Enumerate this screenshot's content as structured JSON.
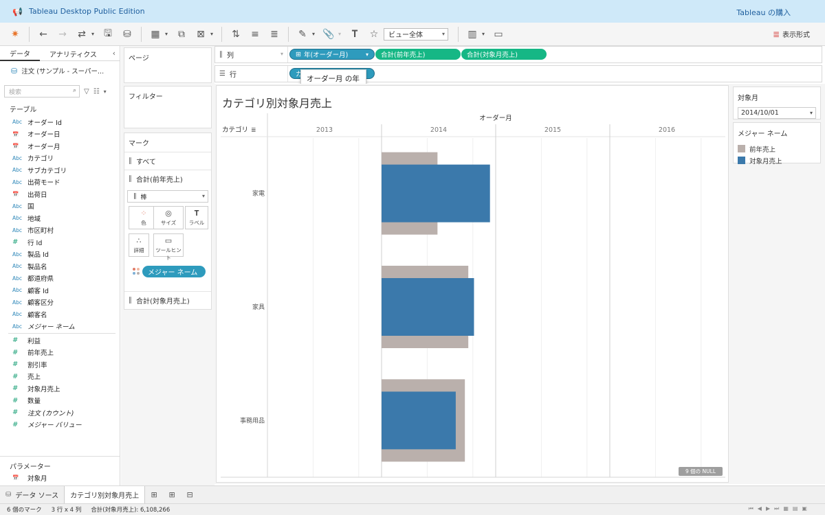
{
  "window": {
    "title": "Tableau Desktop Public Edition",
    "buy_link": "Tableau の購入"
  },
  "toolbar": {
    "view_size": "ビュー全体",
    "show_me": "表示形式",
    "icons": [
      "tableau-logo-icon",
      "undo-icon",
      "redo-icon",
      "replay-icon",
      "save-icon",
      "new-datasource-icon",
      "new-worksheet-icon",
      "duplicate-icon",
      "clear-icon",
      "swap-icon",
      "sort-asc-icon",
      "sort-desc-icon",
      "highlight-icon",
      "group-icon",
      "label-icon",
      "pin-icon",
      "show-cards-icon",
      "presentation-icon"
    ]
  },
  "data_pane": {
    "tabs": [
      "データ",
      "アナリティクス"
    ],
    "datasource": "注文 (サンプル - スーパー...",
    "search_placeholder": "検索",
    "tables_header": "テーブル",
    "dimensions": [
      {
        "type": "Abc",
        "name": "オーダー Id"
      },
      {
        "type": "date",
        "name": "オーダー日"
      },
      {
        "type": "date",
        "name": "オーダー月"
      },
      {
        "type": "Abc",
        "name": "カテゴリ"
      },
      {
        "type": "Abc",
        "name": "サブカテゴリ"
      },
      {
        "type": "Abc",
        "name": "出荷モード"
      },
      {
        "type": "date",
        "name": "出荷日"
      },
      {
        "type": "Abc",
        "name": "国"
      },
      {
        "type": "Abc",
        "name": "地域"
      },
      {
        "type": "Abc",
        "name": "市区町村"
      },
      {
        "type": "#",
        "name": "行 Id"
      },
      {
        "type": "Abc",
        "name": "製品 Id"
      },
      {
        "type": "Abc",
        "name": "製品名"
      },
      {
        "type": "Abc",
        "name": "都道府県"
      },
      {
        "type": "Abc",
        "name": "顧客 Id"
      },
      {
        "type": "Abc",
        "name": "顧客区分"
      },
      {
        "type": "Abc",
        "name": "顧客名"
      },
      {
        "type": "Abc",
        "name": "メジャー ネーム",
        "italic": true
      }
    ],
    "measures": [
      {
        "type": "#",
        "name": "利益"
      },
      {
        "type": "#",
        "name": "前年売上"
      },
      {
        "type": "#",
        "name": "割引率"
      },
      {
        "type": "#",
        "name": "売上"
      },
      {
        "type": "#",
        "name": "対象月売上"
      },
      {
        "type": "#",
        "name": "数量"
      },
      {
        "type": "#",
        "name": "注文 (カウント)",
        "italic": true
      },
      {
        "type": "#",
        "name": "メジャー バリュー",
        "italic": true
      }
    ],
    "parameters_header": "パラメーター",
    "parameters": [
      {
        "type": "date",
        "name": "対象月"
      }
    ]
  },
  "shelves": {
    "pages_label": "ページ",
    "filters_label": "フィルター",
    "marks_label": "マーク",
    "marks_all": "すべて",
    "marks_card1": "合計(前年売上)",
    "mark_type": "棒",
    "mark_buttons": [
      "色",
      "サイズ",
      "ラベル",
      "詳細",
      "ツールヒント"
    ],
    "color_pill": "メジャー ネーム",
    "marks_card2": "合計(対象月売上)",
    "columns_label": "列",
    "rows_label": "行",
    "columns_pills": [
      "年(オーダー月)",
      "合計(前年売上)",
      "合計(対象月売上)"
    ],
    "rows_pill_prefix": "カ",
    "tooltip": "オーダー月 の年"
  },
  "view": {
    "title": "カテゴリ別対象月売上",
    "null_badge": "9 個の NULL"
  },
  "chart_data": {
    "type": "bar",
    "column_header": "オーダー月",
    "row_header": "カテゴリ",
    "years": [
      "2013",
      "2014",
      "2015",
      "2016"
    ],
    "categories": [
      "家電",
      "家具",
      "事務用品"
    ],
    "series": [
      {
        "name": "前年売上",
        "color": "#bab0ac",
        "values": [
          0.49,
          0.76,
          0.73
        ]
      },
      {
        "name": "対象月売上",
        "color": "#3b79ab",
        "values": [
          0.95,
          0.81,
          0.65
        ]
      }
    ],
    "bar_year": "2014",
    "value_scale": "fraction of the 2014 column width"
  },
  "legends": {
    "param_title": "対象月",
    "param_value": "2014/10/01",
    "color_title": "メジャー ネーム",
    "items": [
      {
        "name": "前年売上",
        "color": "#bab0ac"
      },
      {
        "name": "対象月売上",
        "color": "#3b79ab"
      }
    ]
  },
  "bottom": {
    "datasource_tab": "データ ソース",
    "sheet_tab": "カテゴリ別対象月売上"
  },
  "status": {
    "marks": "6 個のマーク",
    "dims": "3 行 x 4 列",
    "sum": "合計(対象月売上): 6,108,266"
  }
}
